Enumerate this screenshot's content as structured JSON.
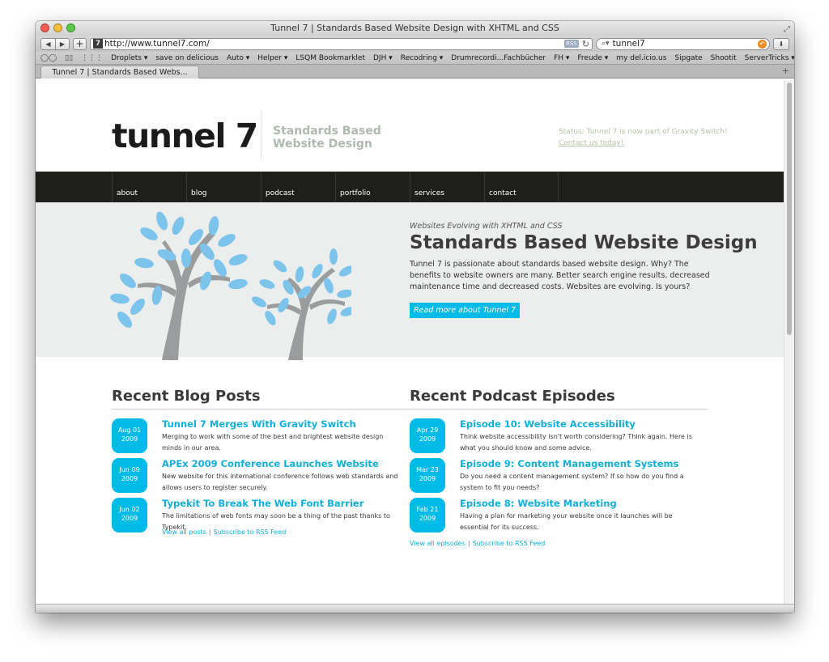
{
  "browser": {
    "window_title": "Tunnel 7 | Standards Based Website Design with XHTML and CSS",
    "url": "http://www.tunnel7.com/",
    "rss_badge": "RSS",
    "search_value": "tunnel7",
    "tab_title": "Tunnel 7 | Standards Based Webs...",
    "favicon_text": "7",
    "bookmarks": [
      "Droplets ▾",
      "save on delicious",
      "Auto ▾",
      "Helper ▾",
      "LSQM Bookmarklet",
      "DJH ▾",
      "Recodring ▾",
      "Drumrecordi...Fachbücher",
      "FH ▾",
      "Freude ▾",
      "my del.icio.us",
      "Sipgate",
      "Shootit",
      "ServerTricks ▾"
    ],
    "bookmarks_overflow": "»"
  },
  "site": {
    "logo": "tunnel 7",
    "tagline_1": "Standards Based",
    "tagline_2": "Website Design",
    "status": "Status: Tunnel 7 is now part of Gravity Switch!",
    "contact": "Contact us today!",
    "nav": [
      "about",
      "blog",
      "podcast",
      "portfolio",
      "services",
      "contact"
    ]
  },
  "hero": {
    "kicker": "Websites Evolving with XHTML and CSS",
    "title": "Standards Based Website Design",
    "text": "Tunnel 7 is passionate about standards based website design. Why? The benefits to website owners are many. Better search engine results, decreased maintenance time and decreased costs. Websites are evolving. Is yours?",
    "button": "Read more about Tunnel 7"
  },
  "blog": {
    "heading": "Recent Blog Posts",
    "posts": [
      {
        "date_1": "Aug 01",
        "date_2": "2009",
        "title": "Tunnel 7 Merges With Gravity Switch",
        "desc": "Merging to work with some of the best and brightest website design minds in our area."
      },
      {
        "date_1": "Jun 09",
        "date_2": "2009",
        "title": "APEx 2009 Conference Launches Website",
        "desc": "New website for this international conference follows web standards and allows users to register securely."
      },
      {
        "date_1": "Jun 02",
        "date_2": "2009",
        "title": "Typekit To Break The Web Font Barrier",
        "desc": "The limitations of web fonts may soon be a thing of the past thanks to Typekit."
      }
    ],
    "view_all": "View all posts",
    "sep": "|",
    "rss": "Subscribe to RSS Feed"
  },
  "podcast": {
    "heading": "Recent Podcast Episodes",
    "posts": [
      {
        "date_1": "Apr 29",
        "date_2": "2009",
        "title": "Episode 10: Website Accessibility",
        "desc": "Think website accessibility isn't worth considering? Think again. Here is what you should know and some advice."
      },
      {
        "date_1": "Mar 23",
        "date_2": "2009",
        "title": "Episode 9: Content Management Systems",
        "desc": "Do you need a content management system? If so how do you find a system to fit you needs?"
      },
      {
        "date_1": "Feb 21",
        "date_2": "2009",
        "title": "Episode 8: Website Marketing",
        "desc": "Having a plan for marketing your website once it launches will be essential for its success."
      }
    ],
    "view_all": "View all episodes",
    "sep": "|",
    "rss": "Subscribe to RSS Feed"
  },
  "colors": {
    "accent": "#00bbe8",
    "nav_bg": "#1e1f1b",
    "hero_bg": "#eceeed",
    "leaf": "#7cc4ec",
    "trunk": "#9b9c9e"
  },
  "icons": [
    "back-arrow-icon",
    "forward-arrow-icon",
    "add-icon",
    "reload-icon",
    "search-icon",
    "snapback-icon",
    "download-icon",
    "reading-glasses-icon",
    "book-icon",
    "grid-icon",
    "resize-icon",
    "tree-illustration"
  ]
}
